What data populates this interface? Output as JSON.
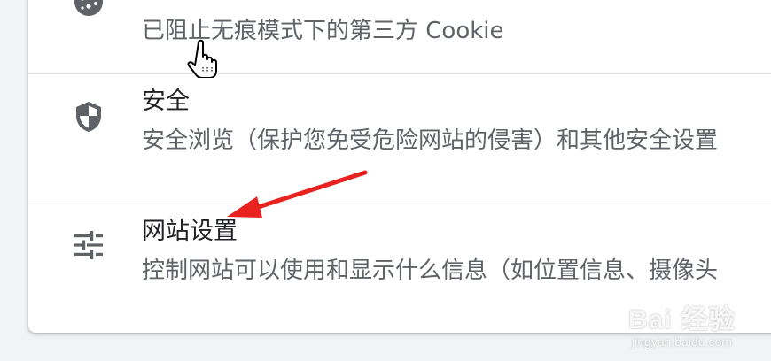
{
  "settings": {
    "items": [
      {
        "title": "",
        "description": "已阻止无痕模式下的第三方 Cookie",
        "icon": "cookie-icon"
      },
      {
        "title": "安全",
        "description": "安全浏览（保护您免受危险网站的侵害）和其他安全设置",
        "icon": "shield-icon"
      },
      {
        "title": "网站设置",
        "description": "控制网站可以使用和显示什么信息（如位置信息、摄像头",
        "icon": "tune-icon"
      }
    ]
  },
  "annotations": {
    "arrow_color": "#e8231f",
    "cursor_icon": "hand-pointer-icon"
  },
  "watermark": {
    "main": "Bai 经验",
    "sub": "jingyan.baidu.com"
  },
  "colors": {
    "title": "#202124",
    "description": "#5f6368",
    "icon": "#5f6368",
    "divider": "#e3e5e8",
    "background": "#f1f3f4"
  }
}
